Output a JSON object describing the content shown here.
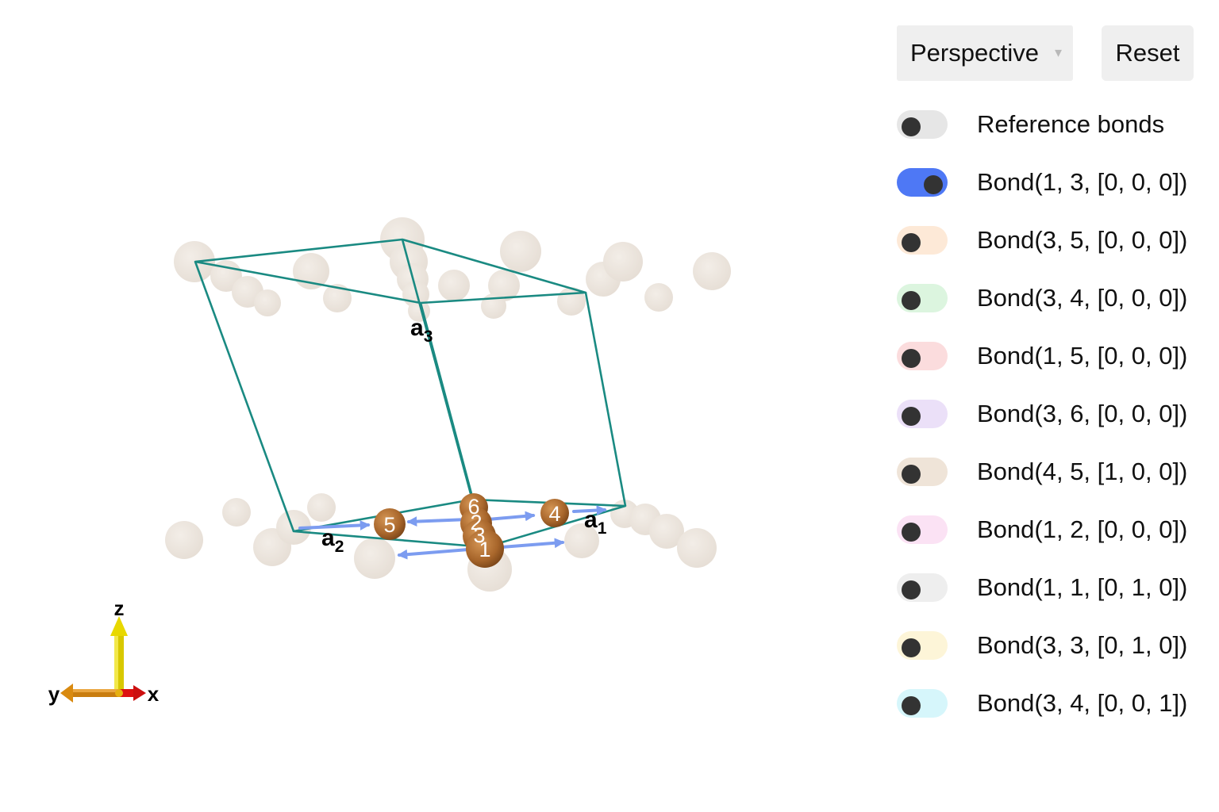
{
  "viewer": {
    "camera_mode": "Perspective",
    "reset_label": "Reset",
    "caret": "▾",
    "lattice_labels": {
      "a1": "a",
      "a1_sub": "1",
      "a2": "a",
      "a2_sub": "2",
      "a3": "a",
      "a3_sub": "3"
    },
    "atom_labels": [
      "5",
      "4",
      "6",
      "2",
      "3",
      "1"
    ],
    "axes_labels": {
      "x": "x",
      "y": "y",
      "z": "z"
    },
    "colors": {
      "cell_edge": "#1a8a82",
      "atom": "#b87030",
      "ghost": "#d8ccbf",
      "bond_arrow": "#7c9cf0",
      "axis_x": "#dd1111",
      "axis_y": "#d98a10",
      "axis_z": "#e0d000"
    }
  },
  "toggles": [
    {
      "label": "Reference bonds",
      "on": false,
      "color": "#e6e6e6"
    },
    {
      "label": "Bond(1, 3, [0, 0, 0])",
      "on": true,
      "color": "#4e78f5"
    },
    {
      "label": "Bond(3, 5, [0, 0, 0])",
      "on": false,
      "color": "#fde9d7"
    },
    {
      "label": "Bond(3, 4, [0, 0, 0])",
      "on": false,
      "color": "#dcf5df"
    },
    {
      "label": "Bond(1, 5, [0, 0, 0])",
      "on": false,
      "color": "#fbdcdd"
    },
    {
      "label": "Bond(3, 6, [0, 0, 0])",
      "on": false,
      "color": "#ebe0f8"
    },
    {
      "label": "Bond(4, 5, [1, 0, 0])",
      "on": false,
      "color": "#efe4d8"
    },
    {
      "label": "Bond(1, 2, [0, 0, 0])",
      "on": false,
      "color": "#fbe2f4"
    },
    {
      "label": "Bond(1, 1, [0, 1, 0])",
      "on": false,
      "color": "#eeeeee"
    },
    {
      "label": "Bond(3, 3, [0, 1, 0])",
      "on": false,
      "color": "#fdf5d8"
    },
    {
      "label": "Bond(3, 4, [0, 0, 1])",
      "on": false,
      "color": "#d6f6fb"
    }
  ]
}
